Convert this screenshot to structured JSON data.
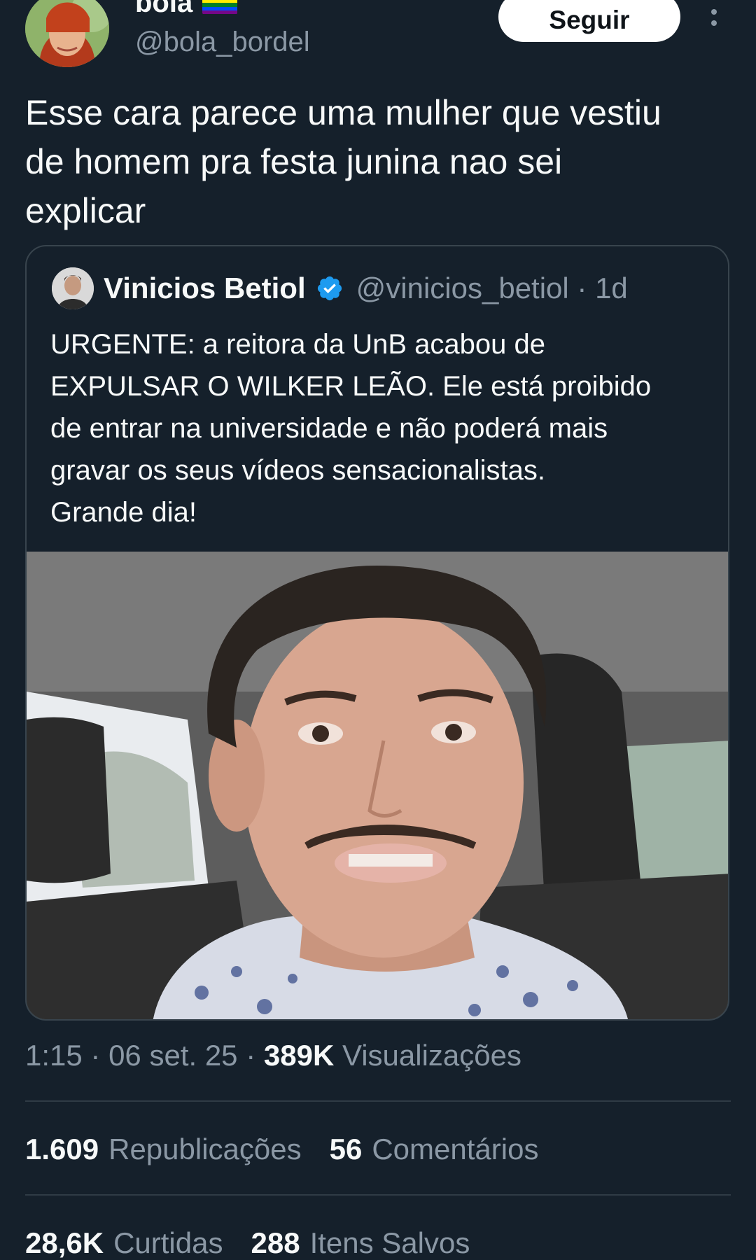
{
  "author": {
    "display_name": "bola",
    "name_emoji": "rainbow-flag-icon",
    "handle": "@bola_bordel"
  },
  "header": {
    "follow_label": "Seguir",
    "more_icon": "more-vertical-icon"
  },
  "tweet": {
    "text_lines": [
      "Esse cara parece uma mulher que vestiu",
      "de homem pra festa junina nao sei",
      "explicar"
    ]
  },
  "quote": {
    "name": "Vinicios Betiol",
    "verified_icon": "verified-badge-icon",
    "handle_time": "@vinicios_betiol · 1d",
    "text_lines": [
      "URGENTE: a reitora da UnB acabou de",
      "EXPULSAR O WILKER LEÃO. Ele está proibido",
      "de entrar na universidade e não poderá mais",
      "gravar os seus vídeos sensacionalistas.",
      "Grande dia!"
    ]
  },
  "meta": {
    "time_date": "1:15 · 06 set. 25 · ",
    "views_count": "389K",
    "views_label": " Visualizações"
  },
  "stats": {
    "reposts_count": "1.609",
    "reposts_label": "Republicações",
    "comments_count": "56",
    "comments_label": "Comentários",
    "likes_count": "28,6K",
    "likes_label": "Curtidas",
    "saves_count": "288",
    "saves_label": "Itens Salvos"
  },
  "colors": {
    "background": "#15202b",
    "primary_text": "#f7f9f9",
    "secondary_text": "#8b98a5",
    "verified": "#1d9bf0",
    "border": "#38444d"
  }
}
